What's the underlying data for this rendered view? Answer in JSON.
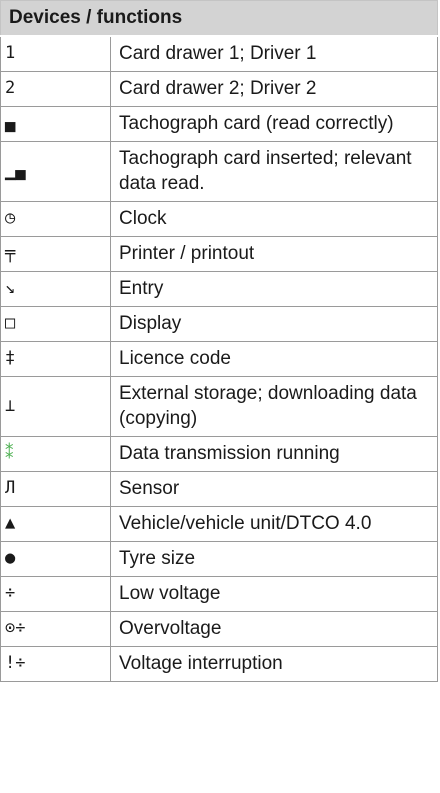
{
  "header": "Devices / functions",
  "rows": [
    {
      "symbol": "1",
      "label": "Card drawer 1; Driver 1"
    },
    {
      "symbol": "2",
      "label": "Card drawer 2; Driver 2"
    },
    {
      "symbol": "▄",
      "label": "Tachograph card (read cor­rectly)"
    },
    {
      "symbol": "▁▄",
      "label": "Tachograph card inserted; rel­evant data read."
    },
    {
      "symbol": "◷",
      "label": "Clock"
    },
    {
      "symbol": "╤",
      "label": "Printer / printout"
    },
    {
      "symbol": "↘",
      "label": "Entry"
    },
    {
      "symbol": "□",
      "label": "Display"
    },
    {
      "symbol": "‡",
      "label": "Licence code"
    },
    {
      "symbol": "⊥",
      "label": "External storage; downloading data (copying)"
    },
    {
      "symbol": "⁑",
      "label": "Data transmission running"
    },
    {
      "symbol": "Л",
      "label": "Sensor"
    },
    {
      "symbol": "▲",
      "label": "Vehicle/vehicle unit/DTCO 4.0"
    },
    {
      "symbol": "●",
      "label": "Tyre size"
    },
    {
      "symbol": "÷",
      "label": "Low voltage"
    },
    {
      "symbol": "⊙÷",
      "label": "Overvoltage"
    },
    {
      "symbol": "!÷",
      "label": "Voltage interruption"
    }
  ]
}
